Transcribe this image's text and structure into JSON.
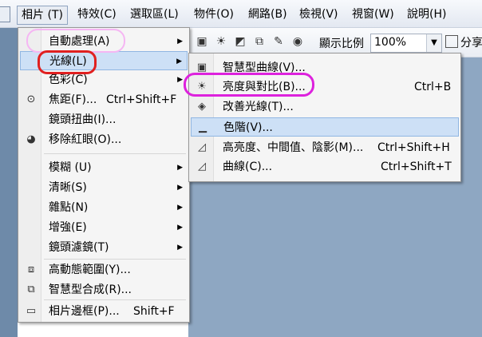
{
  "menubar": {
    "items": [
      {
        "label": "相片 (T)"
      },
      {
        "label": "特效(C)"
      },
      {
        "label": "選取區(L)"
      },
      {
        "label": "物件(O)"
      },
      {
        "label": "網路(B)"
      },
      {
        "label": "檢視(V)"
      },
      {
        "label": "視窗(W)"
      },
      {
        "label": "說明(H)"
      }
    ]
  },
  "toolbar": {
    "zoom_label": "顯示比例",
    "zoom_value": "100%",
    "share_label": "分享"
  },
  "photo_menu": {
    "items": [
      {
        "label": "自動處理(A)",
        "shortcut": "",
        "submenu": true
      },
      {
        "label": "光線(L)",
        "shortcut": "",
        "submenu": true
      },
      {
        "label": "色彩(C)",
        "shortcut": "",
        "submenu": true
      },
      {
        "label": "焦距(F)...",
        "shortcut": "Ctrl+Shift+F",
        "submenu": false
      },
      {
        "label": "鏡頭扭曲(I)...",
        "shortcut": "",
        "submenu": false
      },
      {
        "label": "移除紅眼(O)...",
        "shortcut": "",
        "submenu": false
      },
      {
        "label": "模糊 (U)",
        "shortcut": "",
        "submenu": true
      },
      {
        "label": "清晰(S)",
        "shortcut": "",
        "submenu": true
      },
      {
        "label": "雜點(N)",
        "shortcut": "",
        "submenu": true
      },
      {
        "label": "增強(E)",
        "shortcut": "",
        "submenu": true
      },
      {
        "label": "鏡頭濾鏡(T)",
        "shortcut": "",
        "submenu": true
      },
      {
        "label": "高動態範圍(Y)...",
        "shortcut": "",
        "submenu": false
      },
      {
        "label": "智慧型合成(R)...",
        "shortcut": "",
        "submenu": false
      },
      {
        "label": "相片邊框(P)...",
        "shortcut": "Shift+F",
        "submenu": false
      }
    ]
  },
  "light_menu": {
    "items": [
      {
        "label": "智慧型曲線(V)...",
        "shortcut": ""
      },
      {
        "label": "亮度與對比(B)...",
        "shortcut": "Ctrl+B"
      },
      {
        "label": "改善光線(T)...",
        "shortcut": ""
      },
      {
        "label": "色階(V)...",
        "shortcut": ""
      },
      {
        "label": "高亮度、中間值、陰影(M)...",
        "shortcut": "Ctrl+Shift+H"
      },
      {
        "label": "曲線(C)...",
        "shortcut": "Ctrl+Shift+T"
      }
    ]
  },
  "colors": {
    "highlight": "#cde0f6",
    "mark_red": "#e02020",
    "mark_magenta": "#dd22dd",
    "mark_pink": "#f5b6f3"
  }
}
